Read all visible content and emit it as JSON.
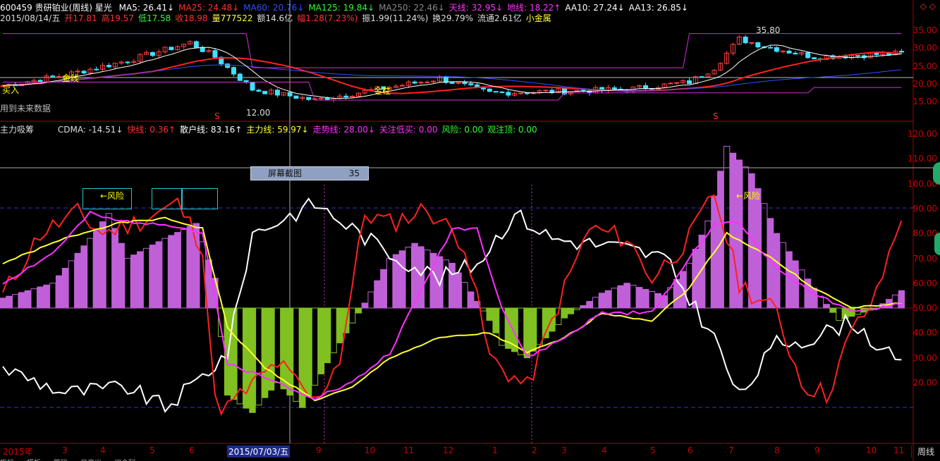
{
  "header": {
    "stock": "600459 贵研铂业(周线) 星光",
    "ma": [
      {
        "label": "MA5: 26.41↓",
        "color": "#ffffff"
      },
      {
        "label": "MA25: 24.48↓",
        "color": "#ff3030"
      },
      {
        "label": "MA60: 20.76↓",
        "color": "#3050ff"
      },
      {
        "label": "MA125: 19.84↓",
        "color": "#30ff30"
      },
      {
        "label": "MA250: 22.46↓",
        "color": "#888888"
      },
      {
        "label": "天线: 32.95↓",
        "color": "#ff30ff"
      },
      {
        "label": "地线: 18.22↑",
        "color": "#ff30ff"
      },
      {
        "label": "AA10: 27.24↓",
        "color": "#ffffff"
      },
      {
        "label": "AA13: 26.85↓",
        "color": "#ffffff"
      }
    ],
    "quote": [
      {
        "label": "2015/08/14/五",
        "color": "#dddddd"
      },
      {
        "label": "开17.81",
        "color": "#ff3030"
      },
      {
        "label": "高19.57",
        "color": "#ff3030"
      },
      {
        "label": "低17.58",
        "color": "#30ff30"
      },
      {
        "label": "收18.98",
        "color": "#ff3030"
      },
      {
        "label": "量777522",
        "color": "#ffff30"
      },
      {
        "label": "额14.6亿",
        "color": "#dddddd"
      },
      {
        "label": "幅1.28(7.23%)",
        "color": "#ff3030"
      },
      {
        "label": "振1.99(11.24%)",
        "color": "#dddddd"
      },
      {
        "label": "换29.79%",
        "color": "#dddddd"
      },
      {
        "label": "流通2.61亿",
        "color": "#dddddd"
      },
      {
        "label": "小金属",
        "color": "#ffff30"
      }
    ],
    "corner": "◇ ◇"
  },
  "price_chart": {
    "buy_label": "买入",
    "future_label": "用到未来数据",
    "low_label": "12.00",
    "high_label": "35.80",
    "golden_labels": [
      "金线",
      "金柱"
    ],
    "s_marks": [
      "S",
      "S"
    ],
    "y_ticks": [
      "35.00",
      "30.00",
      "25.00",
      "20.00",
      "15.00"
    ]
  },
  "indicator": {
    "name": "主力吸筹",
    "values": [
      {
        "label": "CDMA: -14.51↓",
        "color": "#dddddd"
      },
      {
        "label": "快线: 0.36↑",
        "color": "#ff3030"
      },
      {
        "label": "散户线: 83.16↑",
        "color": "#ffffff"
      },
      {
        "label": "主力线: 59.97↓",
        "color": "#ffff30"
      },
      {
        "label": "走势线: 28.00↓",
        "color": "#ff30ff"
      },
      {
        "label": "关注低买: 0.00",
        "color": "#ff30ff"
      },
      {
        "label": "风险: 0.00",
        "color": "#30ff30"
      },
      {
        "label": "观注顶: 0.00",
        "color": "#30ff30"
      }
    ],
    "risk_labels": [
      "←风险",
      "←风险"
    ],
    "y_ticks": [
      "120.00",
      "110.00",
      "100.00",
      "90.00",
      "80.00",
      "70.00",
      "60.00",
      "50.00",
      "40.00",
      "30.00",
      "20.00"
    ]
  },
  "tooltip": {
    "label": "屏幕截图",
    "value": "35"
  },
  "time_axis": {
    "labels": [
      "2015年",
      "3",
      "4",
      "5",
      "6",
      "9",
      "10",
      "11",
      "12",
      "1",
      "2",
      "3",
      "4",
      "5",
      "6",
      "7",
      "8",
      "9",
      "10",
      "11"
    ],
    "cursor_date": "2015/07/03/五",
    "period": "周线"
  },
  "bottom_tabs": [
    "指标",
    "模板",
    "筹码",
    "日产出",
    "组合列"
  ]
}
